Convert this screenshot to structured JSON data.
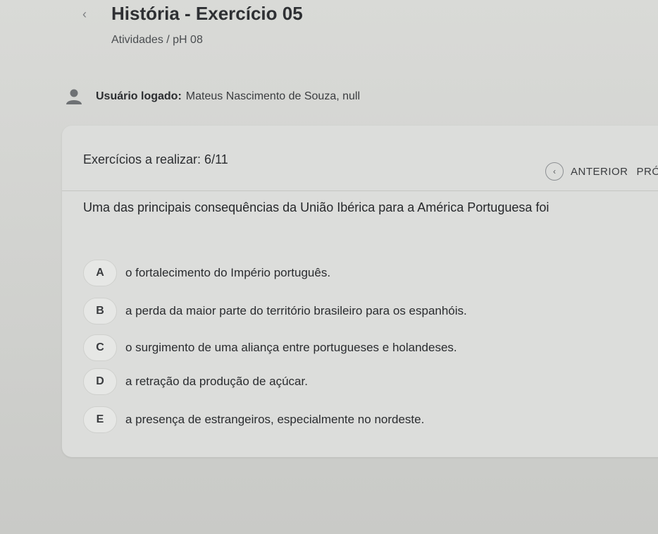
{
  "header": {
    "back_glyph": "‹",
    "title": "História - Exercício 05",
    "breadcrumb": "Atividades / pH 08"
  },
  "user": {
    "label": "Usuário logado:",
    "name": "Mateus Nascimento de Souza, null",
    "icon": "user-icon"
  },
  "exercise": {
    "counter": "Exercícios a realizar: 6/11",
    "nav": {
      "prev_glyph": "‹",
      "prev_label": "ANTERIOR",
      "next_label_partial": "PRÓ"
    },
    "question": "Uma das principais consequências da União Ibérica para a América Portuguesa foi",
    "options": [
      {
        "letter": "A",
        "text": "o fortalecimento do Império português."
      },
      {
        "letter": "B",
        "text": "a perda da maior parte do território brasileiro para os espanhóis."
      },
      {
        "letter": "C",
        "text": "o surgimento de uma aliança entre portugueses e holandeses."
      },
      {
        "letter": "D",
        "text": "a retração da produção de açúcar."
      },
      {
        "letter": "E",
        "text": "a presença de estrangeiros, especialmente no nordeste."
      }
    ]
  },
  "colors": {
    "background": "#d2d3d0",
    "card": "#dcdddb",
    "text": "#2a2c2e"
  }
}
